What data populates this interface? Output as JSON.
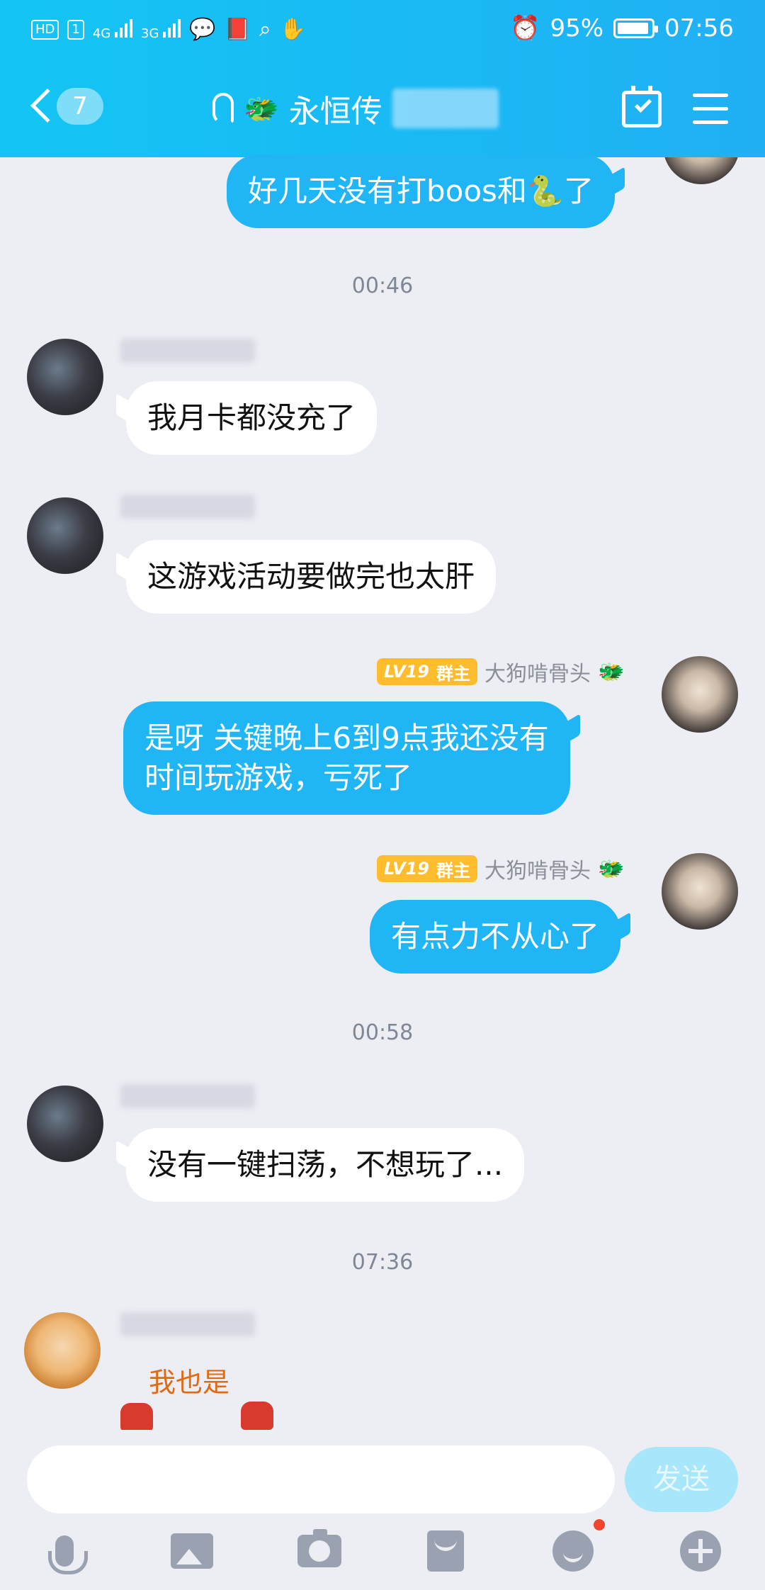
{
  "status_bar": {
    "left_icons": [
      "HD",
      "1",
      "4G",
      "3G",
      "chat-bubble-icon",
      "book-icon",
      "search-icon",
      "hand-icon"
    ],
    "battery": "95%",
    "time": "07:56"
  },
  "header": {
    "back_count": "7",
    "title": "永恒传",
    "calendar_icon": "calendar-check-icon",
    "menu_icon": "menu-icon"
  },
  "messages": [
    {
      "type": "me",
      "text": "好几天没有打boos和🐍了"
    },
    {
      "type": "time",
      "text": "00:46"
    },
    {
      "type": "other",
      "text": "我月卡都没充了"
    },
    {
      "type": "other",
      "text": "这游戏活动要做完也太肝"
    },
    {
      "type": "me",
      "level": "LV19",
      "role": "群主",
      "sender": "大狗啃骨头",
      "text_line1": "是呀  关键晚上6到9点我还没有",
      "text_line2": "时间玩游戏，亏死了"
    },
    {
      "type": "me",
      "level": "LV19",
      "role": "群主",
      "sender": "大狗啃骨头",
      "text": "有点力不从心了"
    },
    {
      "type": "time",
      "text": "00:58"
    },
    {
      "type": "other",
      "text": "没有一键扫荡，不想玩了..."
    },
    {
      "type": "time",
      "text": "07:36"
    },
    {
      "type": "other-sticker",
      "text": "我也是"
    }
  ],
  "input": {
    "placeholder": "",
    "send_label": "发送"
  },
  "colors": {
    "header_gradient_start": "#14c5f3",
    "my_bubble": "#20b5f4",
    "badge": "#ffbd2d",
    "background": "#eceef4"
  }
}
